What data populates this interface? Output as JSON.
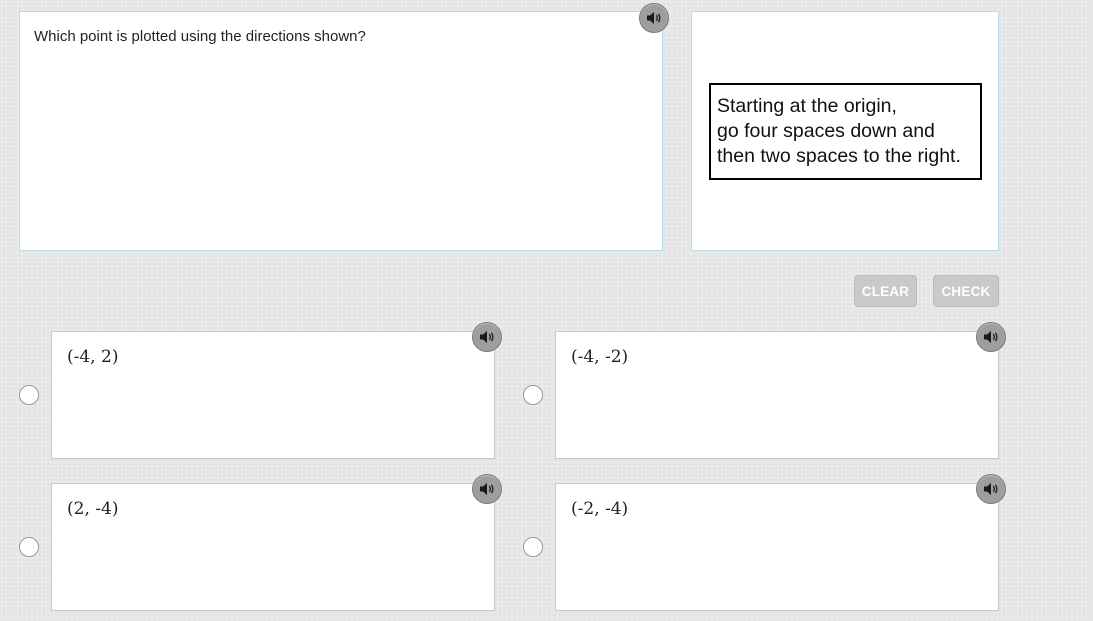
{
  "question": {
    "text": "Which point is plotted using the directions shown?",
    "speaker_icon": "speaker-icon"
  },
  "directions": {
    "lines": [
      "Starting at the origin,",
      "go four spaces down and",
      "then two spaces to the right."
    ]
  },
  "buttons": {
    "clear_label": "CLEAR",
    "check_label": "CHECK"
  },
  "choices": [
    {
      "label": "(-4, 2)",
      "selected": false
    },
    {
      "label": "(-4, -2)",
      "selected": false
    },
    {
      "label": "(2, -4)",
      "selected": false
    },
    {
      "label": "(-2, -4)",
      "selected": false
    }
  ],
  "colors": {
    "background": "#e6e6e6",
    "panel_border": "#b9dbe8",
    "button_disabled": "#c9c9c9",
    "speaker": "#9e9e9e"
  }
}
